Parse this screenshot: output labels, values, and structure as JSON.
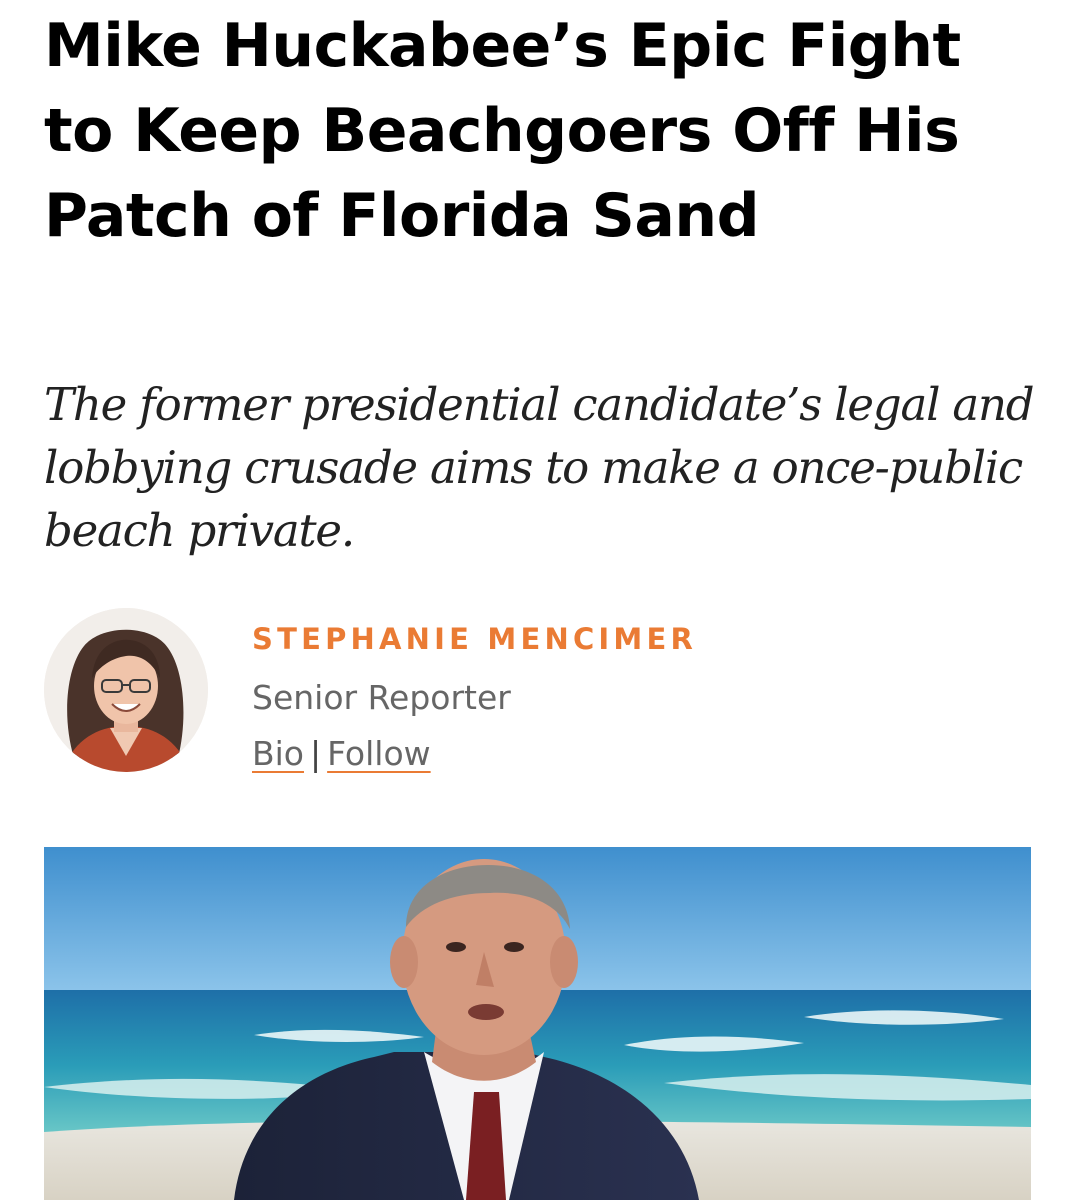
{
  "article": {
    "headline": "Mike Huckabee’s Epic Fight to Keep Beachgoers Off His Patch of Florida Sand",
    "dek": "The former presidential candidate’s legal and lobbying crusade aims to make a once-public beach private."
  },
  "author": {
    "name": "STEPHANIE MENCIMER",
    "title": "Senior Reporter",
    "bio_link": "Bio",
    "separator": "|",
    "follow_link": "Follow"
  },
  "colors": {
    "accent": "#ea7b34",
    "headline": "#000000",
    "meta_text": "#666666"
  },
  "icons": {
    "author_photo": "author-avatar-photo",
    "hero_image": "hero-photo-beach-portrait"
  }
}
